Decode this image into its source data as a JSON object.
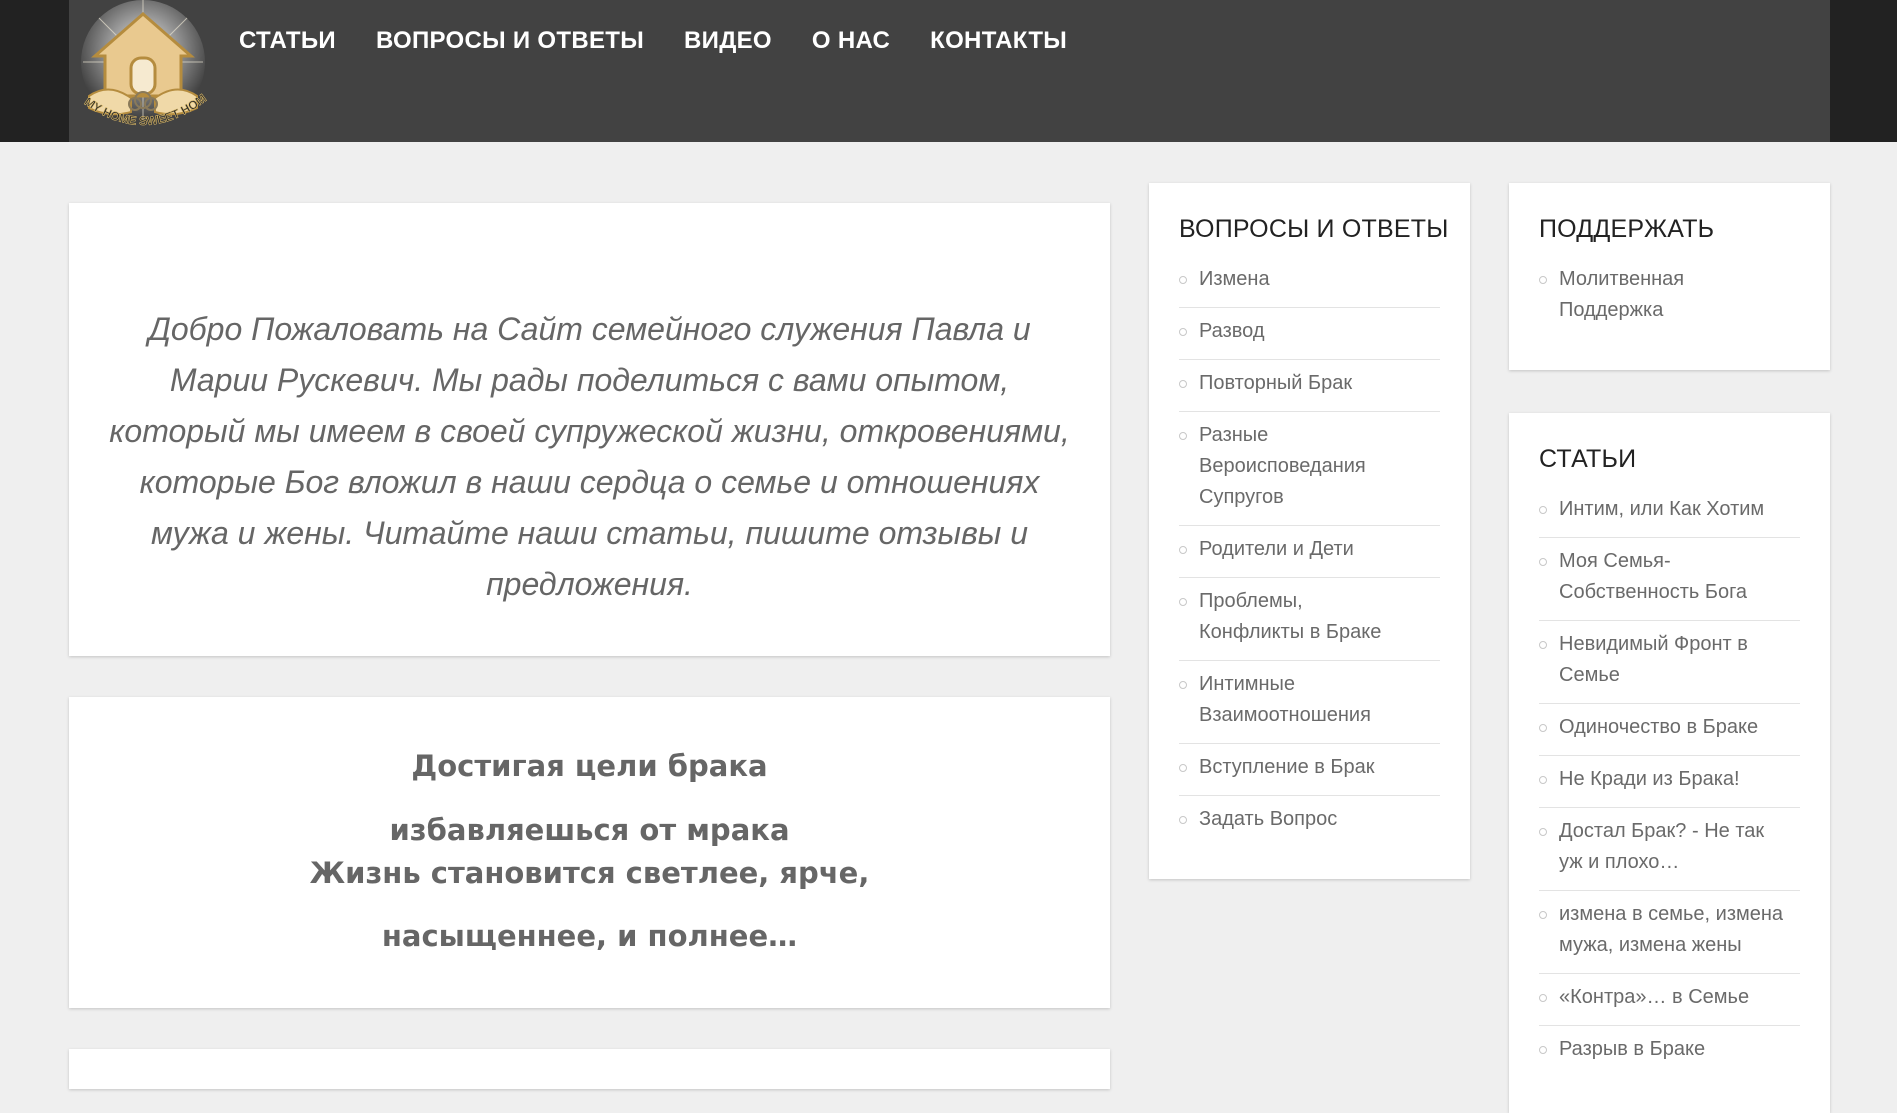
{
  "header": {
    "logo_text": "MY HOME SWEET HOME",
    "nav": [
      {
        "label": "СТАТЬИ"
      },
      {
        "label": "ВОПРОСЫ И ОТВЕТЫ"
      },
      {
        "label": "ВИДЕО"
      },
      {
        "label": "О НАС"
      },
      {
        "label": "КОНТАКТЫ"
      }
    ]
  },
  "welcome": {
    "text": "Добро Пожаловать на Сайт семейного служения Павла и Марии Рускевич. Мы рады поделиться с вами опытом, который мы имеем в своей супружеской жизни, откровениями, которые Бог вложил в наши сердца о семье и отношениях мужа и жены. Читайте наши статьи, пишите отзывы и предложения."
  },
  "marriage": {
    "line1": "Достигая цели брака",
    "line2": "избавляешься от мрака",
    "line3": "Жизнь становится светлее, ярче,",
    "line4": "насыщеннее, и полнее…"
  },
  "qa_widget": {
    "title": "ВОПРОСЫ И ОТВЕТЫ",
    "items": [
      {
        "label": "Измена"
      },
      {
        "label": "Развод"
      },
      {
        "label": "Повторный Брак"
      },
      {
        "label": "Разные Вероисповедания Супругов"
      },
      {
        "label": "Родители и Дети"
      },
      {
        "label": "Проблемы, Конфликты в Браке"
      },
      {
        "label": "Интимные Взаимоотношения"
      },
      {
        "label": "Вступление в Брак"
      },
      {
        "label": "Задать Вопрос"
      }
    ]
  },
  "support_widget": {
    "title": "ПОДДЕРЖАТЬ",
    "items": [
      {
        "label": "Молитвенная Поддержка"
      }
    ]
  },
  "articles_widget": {
    "title": "СТАТЬИ",
    "items": [
      {
        "label": "Интим, или Как Хотим"
      },
      {
        "label": "Моя Семья-Собственность Бога"
      },
      {
        "label": "Невидимый Фронт в Семье"
      },
      {
        "label": "Одиночество в Браке"
      },
      {
        "label": "Не Кради из Брака!"
      },
      {
        "label": "Достал Брак? - Не так уж и плохо…"
      },
      {
        "label": "измена в семье, измена мужа, измена жены"
      },
      {
        "label": "«Контра»… в Семье"
      },
      {
        "label": "Разрыв в Браке"
      }
    ]
  },
  "colors": {
    "header_bg": "#424242",
    "page_bg": "#efefef",
    "nav_text": "#ffffff"
  }
}
